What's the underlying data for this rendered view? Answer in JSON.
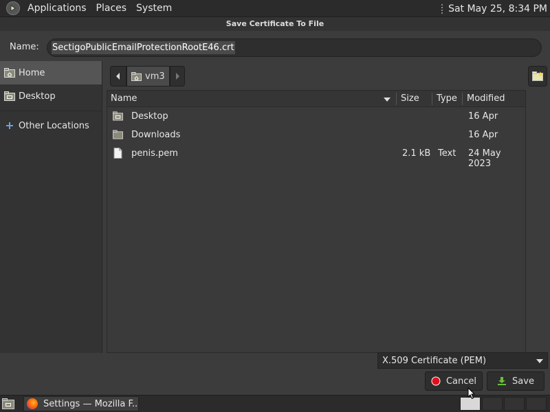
{
  "top_panel": {
    "menus": [
      "Applications",
      "Places",
      "System"
    ],
    "clock": "Sat May 25,  8:34 PM"
  },
  "dialog": {
    "title": "Save Certificate To File",
    "name_label": "Name:",
    "name_value": "SectigoPublicEmailProtectionRootE46.crt",
    "sidebar": [
      {
        "label": "Home",
        "icon": "home-folder-icon",
        "active": true
      },
      {
        "label": "Desktop",
        "icon": "desktop-folder-icon"
      },
      {
        "label": "Other Locations",
        "icon": "plus-icon"
      }
    ],
    "path": {
      "current": "vm3"
    },
    "columns": {
      "name": "Name",
      "size": "Size",
      "type": "Type",
      "modified": "Modified"
    },
    "files": [
      {
        "name": "Desktop",
        "size": "",
        "type": "",
        "modified": "16 Apr",
        "icon": "desktop-folder-icon"
      },
      {
        "name": "Downloads",
        "size": "",
        "type": "",
        "modified": "16 Apr",
        "icon": "folder-icon"
      },
      {
        "name": "penis.pem",
        "size": "2.1 kB",
        "type": "Text",
        "modified": "24 May 2023",
        "icon": "text-file-icon"
      }
    ],
    "filter": "X.509 Certificate (PEM)",
    "cancel_label": "Cancel",
    "save_label": "Save"
  },
  "taskbar": {
    "task_label": "Settings — Mozilla F..."
  },
  "colors": {
    "panel_bg": "#2b2b2b",
    "dialog_bg": "#3c3c3c",
    "selection": "#555555",
    "cancel_red": "#e0101a",
    "save_green": "#6abf3a"
  }
}
